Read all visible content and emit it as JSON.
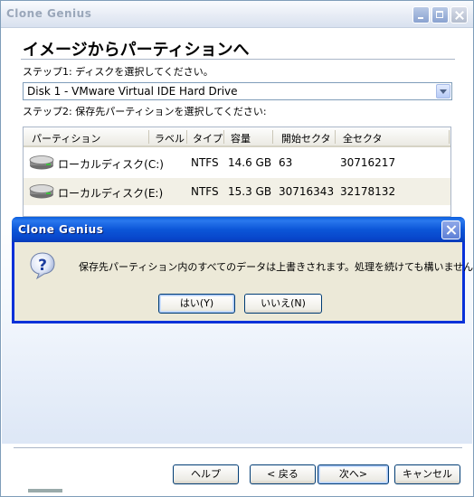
{
  "window": {
    "title": "Clone Genius"
  },
  "page": {
    "heading": "イメージからパーティションへ",
    "step1": "ステップ1: ディスクを選択してください。",
    "disk_select_value": "Disk 1 - VMware Virtual IDE Hard Drive",
    "step2": "ステップ2: 保存先パーティションを選択してください:"
  },
  "table": {
    "headers": [
      "パーティション",
      "ラベル",
      "タイプ",
      "容量",
      "開始セクタ",
      "全セクタ"
    ],
    "rows": [
      {
        "partition": "ローカルディスク(C:)",
        "label": "",
        "type": "NTFS",
        "size": "14.6 GB",
        "start": "63",
        "total": "30716217",
        "icon": "hard-disk-icon"
      },
      {
        "partition": "ローカルディスク(E:)",
        "label": "",
        "type": "NTFS",
        "size": "15.3 GB",
        "start": "30716343",
        "total": "32178132",
        "icon": "hard-disk-icon"
      }
    ]
  },
  "footer": {
    "help": "ヘルプ",
    "back": "< 戻る",
    "next": "次へ>",
    "cancel": "キャンセル"
  },
  "dialog": {
    "title": "Clone Genius",
    "icon": "question-icon",
    "message": "保存先パーティション内のすべてのデータは上書きされます。処理を続けても構いませんか？",
    "yes": "はい(Y)",
    "no": "いいえ(N)"
  },
  "colors": {
    "dialog_titlebar": "#0a4fd6",
    "dialog_border": "#0831d9",
    "dialog_face": "#ece9d8",
    "row_alt": "#f2f0e6"
  }
}
